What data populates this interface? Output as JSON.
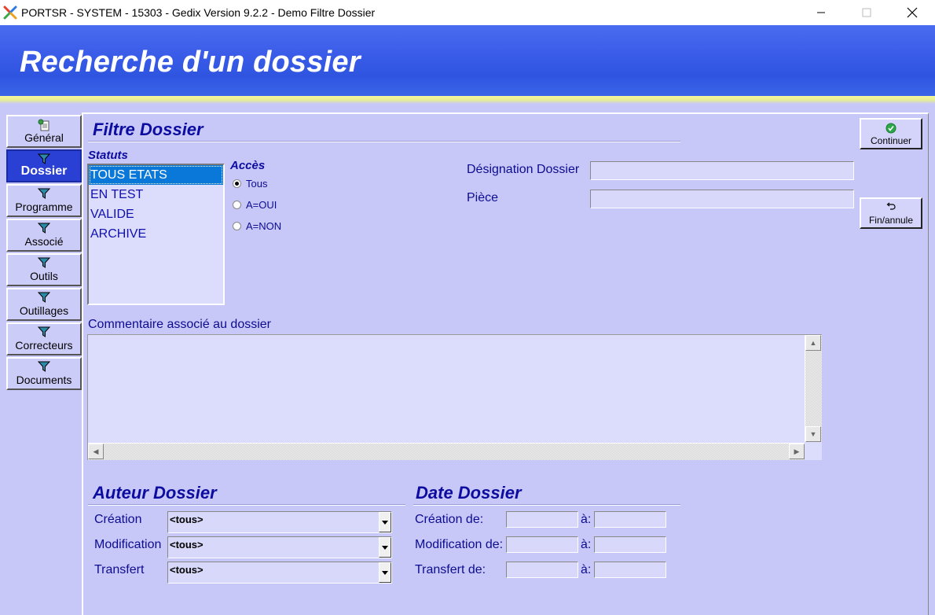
{
  "window": {
    "title": "PORTSR - SYSTEM - 15303 - Gedix Version 9.2.2 - Demo Filtre Dossier",
    "icon": "gedix-x-icon"
  },
  "header": {
    "title": "Recherche d'un dossier"
  },
  "nav": {
    "items": [
      {
        "label": "Général",
        "icon": "document-globe-icon"
      },
      {
        "label": "Dossier",
        "icon": "filter-icon"
      },
      {
        "label": "Programme",
        "icon": "filter-icon"
      },
      {
        "label": "Associé",
        "icon": "filter-icon"
      },
      {
        "label": "Outils",
        "icon": "filter-icon"
      },
      {
        "label": "Outillages",
        "icon": "filter-icon"
      },
      {
        "label": "Correcteurs",
        "icon": "filter-icon"
      },
      {
        "label": "Documents",
        "icon": "filter-icon"
      }
    ],
    "active": "Dossier"
  },
  "filtre": {
    "title": "Filtre Dossier",
    "statuts_label": "Statuts",
    "statuts": [
      "TOUS ETATS",
      "EN TEST",
      "VALIDE",
      "ARCHIVE"
    ],
    "statuts_selected": "TOUS ETATS",
    "acces_label": "Accès",
    "acces_options": [
      "Tous",
      "A=OUI",
      "A=NON"
    ],
    "acces_selected": "Tous",
    "designation_label": "Désignation Dossier",
    "designation_value": "",
    "piece_label": "Pièce",
    "piece_value": "",
    "commentaire_label": "Commentaire associé au dossier",
    "commentaire_value": ""
  },
  "buttons": {
    "continuer": "Continuer",
    "fin_annule": "Fin/annule"
  },
  "auteur": {
    "title": "Auteur Dossier",
    "rows": [
      {
        "label": "Création",
        "value": "<tous>"
      },
      {
        "label": "Modification",
        "value": "<tous>"
      },
      {
        "label": "Transfert",
        "value": "<tous>"
      }
    ]
  },
  "date": {
    "title": "Date Dossier",
    "a_label": "à:",
    "rows": [
      {
        "label": "Création de:",
        "from": "",
        "to": ""
      },
      {
        "label": "Modification de:",
        "from": "",
        "to": ""
      },
      {
        "label": "Transfert de:",
        "from": "",
        "to": ""
      }
    ]
  },
  "colors": {
    "banner": "#3a5ce8",
    "background": "#c8c8f8",
    "heading": "#0c0ca0",
    "active_nav": "#2a3fd4",
    "selection": "#0a78d8"
  }
}
